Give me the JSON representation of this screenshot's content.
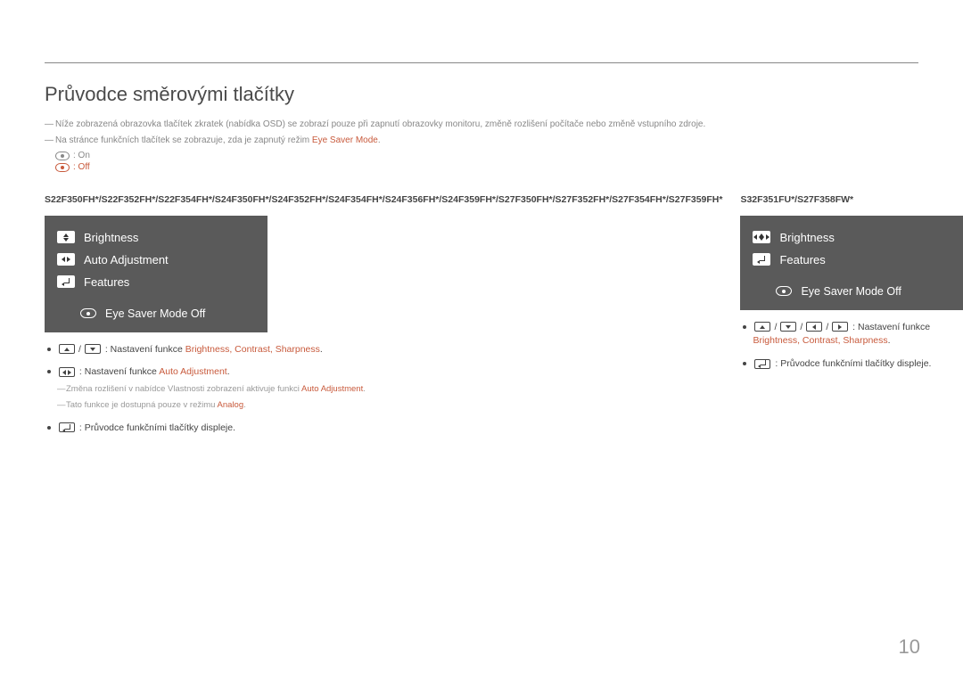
{
  "page": {
    "title": "Průvodce směrovými tlačítky",
    "page_number": "10"
  },
  "notes": {
    "note1": "Níže zobrazená obrazovka tlačítek zkratek (nabídka OSD) se zobrazí pouze při zapnutí obrazovky monitoru, změně rozlišení počítače nebo změně vstupního zdroje.",
    "note2_prefix": "Na stránce funkčních tlačítek se zobrazuje, zda je zapnutý režim ",
    "note2_hl": "Eye Saver Mode",
    "note2_suffix": ".",
    "eye_on": ": On",
    "eye_off": ": Off"
  },
  "left": {
    "models": "S22F350FH*/S22F352FH*/S22F354FH*/S24F350FH*/S24F352FH*/S24F354FH*/S24F356FH*/S24F359FH*/S27F350FH*/S27F352FH*/S27F354FH*/S27F359FH*",
    "osd": {
      "row1": "Brightness",
      "row2": "Auto Adjustment",
      "row3": "Features",
      "status": "Eye Saver Mode Off"
    },
    "b1_prefix": ": Nastavení funkce ",
    "b1_hl": "Brightness, Contrast, Sharpness",
    "b1_suffix": ".",
    "b2_prefix": ": Nastavení funkce ",
    "b2_hl": "Auto Adjustment",
    "b2_suffix": ".",
    "b2_sub1_prefix": "Změna rozlišení v nabídce Vlastnosti zobrazení aktivuje funkci ",
    "b2_sub1_hl": "Auto Adjustment",
    "b2_sub1_suffix": ".",
    "b2_sub2_prefix": "Tato funkce je dostupná pouze v režimu ",
    "b2_sub2_hl": "Analog",
    "b2_sub2_suffix": ".",
    "b3": ": Průvodce funkčními tlačítky displeje."
  },
  "right": {
    "models": "S32F351FU*/S27F358FW*",
    "osd": {
      "row1": "Brightness",
      "row2": "Features",
      "status": "Eye Saver Mode Off"
    },
    "b1_prefix": ": Nastavení funkce ",
    "b1_hl": "Brightness, Contrast, Sharpness",
    "b1_suffix": ".",
    "b2": ": Průvodce funkčními tlačítky displeje."
  }
}
